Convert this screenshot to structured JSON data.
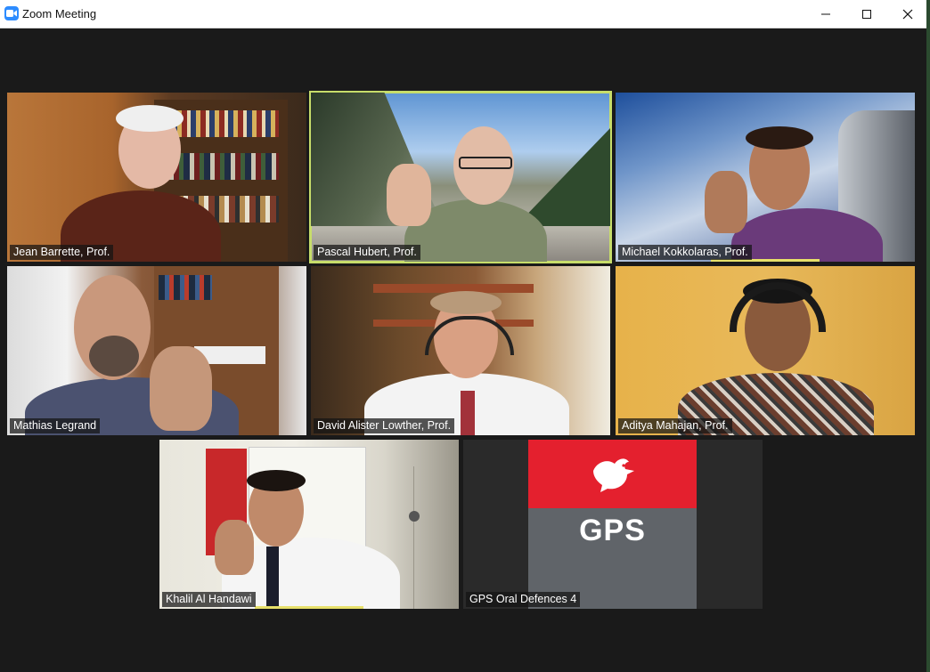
{
  "window": {
    "title": "Zoom Meeting",
    "icon": "zoom-video-icon",
    "controls": [
      "minimize-icon",
      "maximize-icon",
      "close-icon"
    ]
  },
  "participants": [
    {
      "name": "Jean Barrette, Prof."
    },
    {
      "name": "Pascal Hubert, Prof.",
      "active_speaker": true
    },
    {
      "name": "Michael Kokkolaras, Prof."
    },
    {
      "name": "Mathias Legrand"
    },
    {
      "name": "David Alister Lowther, Prof."
    },
    {
      "name": "Aditya Mahajan, Prof."
    },
    {
      "name": "Khalil Al Handawi"
    },
    {
      "name": "GPS Oral Defences 4"
    }
  ],
  "gps_card": {
    "logo_text": "GPS",
    "colors": {
      "red": "#e4202e",
      "gray": "#606469"
    }
  },
  "colors": {
    "background": "#1a1a1a",
    "active_border": "#c7dd6a",
    "zoom_blue": "#2d8cff"
  }
}
